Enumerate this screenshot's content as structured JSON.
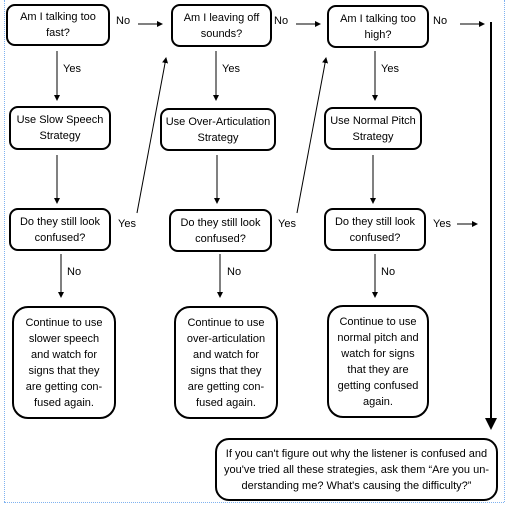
{
  "nodes": {
    "q_fast": "Am I talking too\nfast?",
    "q_sounds": "Am I leaving off\nsounds?",
    "q_high": "Am I talking too\nhigh?",
    "s_slow": "Use Slow Speech\nStrategy",
    "s_over": "Use Over-Articulation\nStrategy",
    "s_pitch": "Use Normal Pitch\nStrategy",
    "c1": "Do they still look\nconfused?",
    "c2": "Do they still look\nconfused?",
    "c3": "Do they still look\nconfused?",
    "r_slow": "Continue to use\nslower speech\nand watch for\nsigns that they\nare getting con-\nfused again.",
    "r_over": "Continue to use\nover-articulation\nand watch for\nsigns that they\nare getting con-\nfused again.",
    "r_pitch": "Continue to use\nnormal pitch and\nwatch for signs\nthat they are\ngetting confused\nagain.",
    "final": "If you can't figure out why the listener is confused and\nyou've tried all these strategies, ask them “Are you un-\nderstanding me?  What's causing the difficulty?”"
  },
  "labels": {
    "no": "No",
    "yes": "Yes"
  }
}
